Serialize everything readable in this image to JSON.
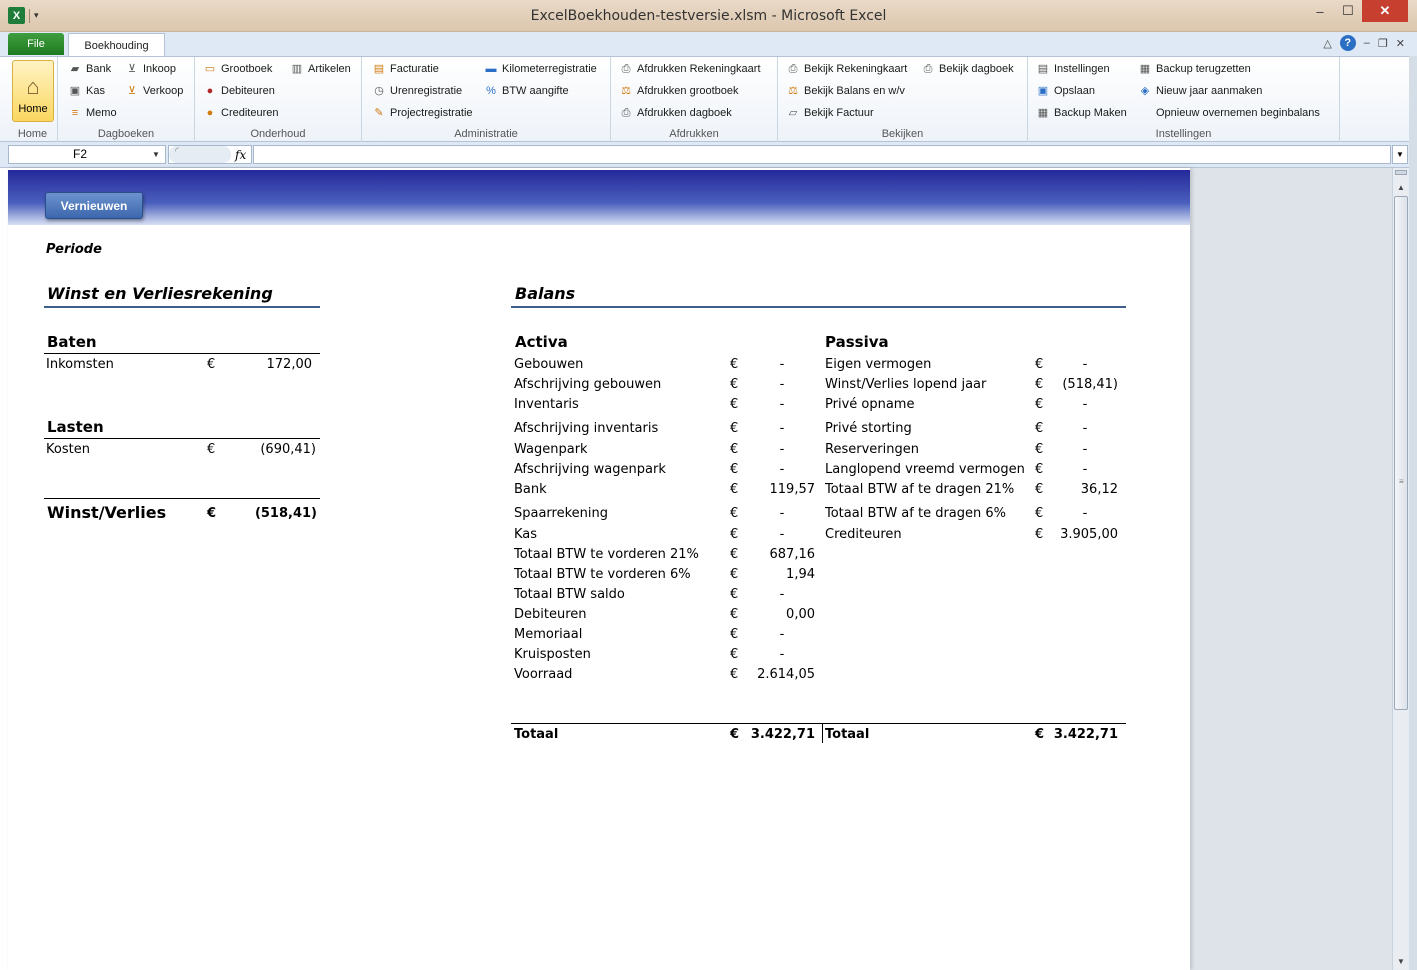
{
  "window": {
    "title": "ExcelBoekhouden-testversie.xlsm  -  Microsoft Excel",
    "minimize": "–",
    "maximize": "☐",
    "close": "✕"
  },
  "quick_access": {
    "app_icon": "X",
    "dropdown": "▾"
  },
  "tabs": {
    "file": "File",
    "active": "Boekhouding"
  },
  "ribbon_right": {
    "collapse": "△",
    "help": "?",
    "min": "–",
    "restore": "❐",
    "close": "✕"
  },
  "ribbon": {
    "home": {
      "button": "Home",
      "label": "Home"
    },
    "dagboeken": {
      "label": "Dagboeken",
      "bank": "Bank",
      "kas": "Kas",
      "memo": "Memo",
      "inkoop": "Inkoop",
      "verkoop": "Verkoop"
    },
    "onderhoud": {
      "label": "Onderhoud",
      "grootboek": "Grootboek",
      "debiteuren": "Debiteuren",
      "crediteuren": "Crediteuren",
      "artikelen": "Artikelen"
    },
    "administratie": {
      "label": "Administratie",
      "facturatie": "Facturatie",
      "uren": "Urenregistratie",
      "project": "Projectregistratie",
      "km": "Kilometerregistratie",
      "btw": "BTW aangifte"
    },
    "afdrukken": {
      "label": "Afdrukken",
      "rek": "Afdrukken Rekeningkaart",
      "grootboek": "Afdrukken grootboek",
      "dagboek": "Afdrukken dagboek"
    },
    "bekijken": {
      "label": "Bekijken",
      "rek": "Bekijk Rekeningkaart",
      "balans": "Bekijk Balans en w/v",
      "factuur": "Bekijk Factuur",
      "dagboek": "Bekijk dagboek"
    },
    "instellingen": {
      "label": "Instellingen",
      "inst": "Instellingen",
      "opslaan": "Opslaan",
      "backup": "Backup Maken",
      "terug": "Backup terugzetten",
      "nieuw": "Nieuw jaar aanmaken",
      "opnieuw": "Opnieuw overnemen beginbalans"
    }
  },
  "formula_bar": {
    "cell": "F2",
    "fx": "fx",
    "value": ""
  },
  "sheet": {
    "refresh": "Vernieuwen",
    "periode": "Periode",
    "wv_title": "Winst en Verliesrekening",
    "baten": "Baten",
    "inkomsten": {
      "label": "Inkomsten",
      "cur": "€",
      "value": "172,00"
    },
    "lasten": "Lasten",
    "kosten": {
      "label": "Kosten",
      "cur": "€",
      "value": "(690,41)"
    },
    "wv_total": {
      "label": "Winst/Verlies",
      "cur": "€",
      "value": "(518,41)"
    },
    "balans_title": "Balans",
    "activa_title": "Activa",
    "passiva_title": "Passiva",
    "activa": [
      {
        "label": "Gebouwen",
        "cur": "€",
        "value": "-"
      },
      {
        "label": "Afschrijving gebouwen",
        "cur": "€",
        "value": "-"
      },
      {
        "label": "Inventaris",
        "cur": "€",
        "value": "-"
      },
      {
        "label": "Afschrijving inventaris",
        "cur": "€",
        "value": "-"
      },
      {
        "label": "Wagenpark",
        "cur": "€",
        "value": "-"
      },
      {
        "label": "Afschrijving wagenpark",
        "cur": "€",
        "value": "-"
      },
      {
        "label": "Bank",
        "cur": "€",
        "value": "119,57"
      },
      {
        "label": "Spaarrekening",
        "cur": "€",
        "value": "-"
      },
      {
        "label": "Kas",
        "cur": "€",
        "value": "-"
      },
      {
        "label": "Totaal BTW te vorderen 21%",
        "cur": "€",
        "value": "687,16"
      },
      {
        "label": "Totaal BTW te vorderen 6%",
        "cur": "€",
        "value": "1,94"
      },
      {
        "label": "Totaal BTW saldo",
        "cur": "€",
        "value": "-"
      },
      {
        "label": "Debiteuren",
        "cur": "€",
        "value": "0,00"
      },
      {
        "label": "Memoriaal",
        "cur": "€",
        "value": "-"
      },
      {
        "label": "Kruisposten",
        "cur": "€",
        "value": "-"
      },
      {
        "label": "Voorraad",
        "cur": "€",
        "value": "2.614,05"
      }
    ],
    "passiva": [
      {
        "label": "Eigen vermogen",
        "cur": "€",
        "value": "-"
      },
      {
        "label": "Winst/Verlies lopend jaar",
        "cur": "€",
        "value": "(518,41)"
      },
      {
        "label": "Privé opname",
        "cur": "€",
        "value": "-"
      },
      {
        "label": "Privé storting",
        "cur": "€",
        "value": "-"
      },
      {
        "label": "Reserveringen",
        "cur": "€",
        "value": "-"
      },
      {
        "label": "Langlopend vreemd vermogen /L",
        "cur": "€",
        "value": "-"
      },
      {
        "label": "Totaal BTW af te dragen 21%",
        "cur": "€",
        "value": "36,12"
      },
      {
        "label": "Totaal BTW af te dragen 6%",
        "cur": "€",
        "value": "-"
      },
      {
        "label": "Crediteuren",
        "cur": "€",
        "value": "3.905,00"
      }
    ],
    "activa_total": {
      "label": "Totaal",
      "cur": "€",
      "value": "3.422,71"
    },
    "passiva_total": {
      "label": "Totaal",
      "cur": "€",
      "value": "3.422,71"
    }
  }
}
